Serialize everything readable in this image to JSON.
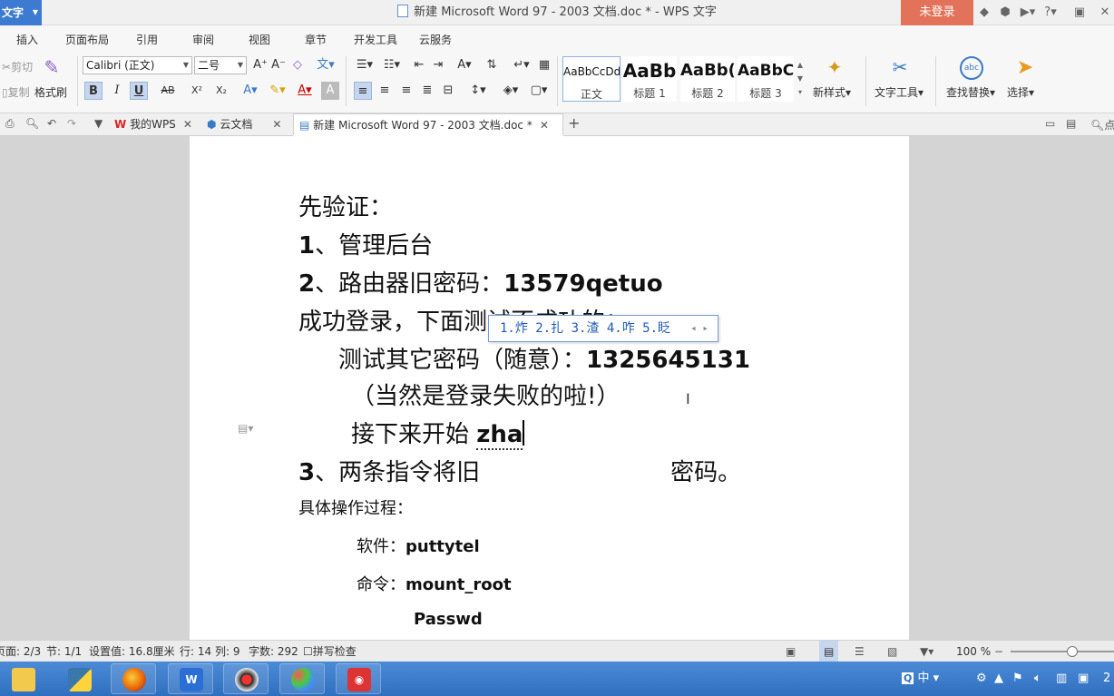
{
  "titlebar": {
    "app_label": "文字",
    "title": "新建 Microsoft Word 97 - 2003 文档.doc * - WPS 文字",
    "login": "未登录",
    "help": "?"
  },
  "menu": [
    "插入",
    "页面布局",
    "引用",
    "审阅",
    "视图",
    "章节",
    "开发工具",
    "云服务"
  ],
  "ribbon": {
    "cut": "剪切",
    "copy": "复制",
    "format_painter": "格式刷",
    "font_name": "Calibri (正文)",
    "font_size": "二号",
    "bold": "B",
    "italic": "I",
    "underline": "U",
    "strike": "AB",
    "superscript": "X²",
    "subscript": "X₂",
    "styles": [
      {
        "preview": "AaBbCcDd",
        "caption": "正文"
      },
      {
        "preview": "AaBb",
        "caption": "标题 1"
      },
      {
        "preview": "AaBb(",
        "caption": "标题 2"
      },
      {
        "preview": "AaBbC",
        "caption": "标题 3"
      }
    ],
    "new_style": "新样式",
    "text_tools": "文字工具",
    "find_replace": "查找替换",
    "select": "选择"
  },
  "tabs": [
    {
      "label": "我的WPS"
    },
    {
      "label": "云文档"
    },
    {
      "label": "新建 Microsoft Word 97 - 2003 文档.doc *"
    }
  ],
  "document": {
    "line1": "先验证：",
    "line2_num": "1",
    "line2": "、管理后台",
    "line3_num": "2",
    "line3": "、路由器旧密码：",
    "line3_pw": "13579qetuo",
    "line4": "成功登录，下面测试不成功的：",
    "line5": "测试其它密码（随意）：",
    "line5_pw": "1325645131",
    "line6": "（当然是登录失败的啦!）",
    "line7": "接下来开始",
    "line7_input": "zha",
    "line8_num": "3",
    "line8": "、两条指令将旧",
    "line8_end": "密码。",
    "line9": "具体操作过程：",
    "line10_label": "软件：",
    "line10_val": "puttytel",
    "line11_label": "命令：",
    "line11_val": "mount_root",
    "line12": "Passwd"
  },
  "ime_candidates": "1.炸 2.扎 3.渣 4.咋 5.眨",
  "status": {
    "page": "页面: 2/3",
    "section": "节: 1/1",
    "position": "设置值: 16.8厘米",
    "row": "行: 14",
    "col": "列: 9",
    "words": "字数: 292",
    "spell": "拼写检查",
    "zoom": "100 %",
    "zoom_level": 0.6
  },
  "taskbar": {
    "ime": "中",
    "clock": "2"
  }
}
